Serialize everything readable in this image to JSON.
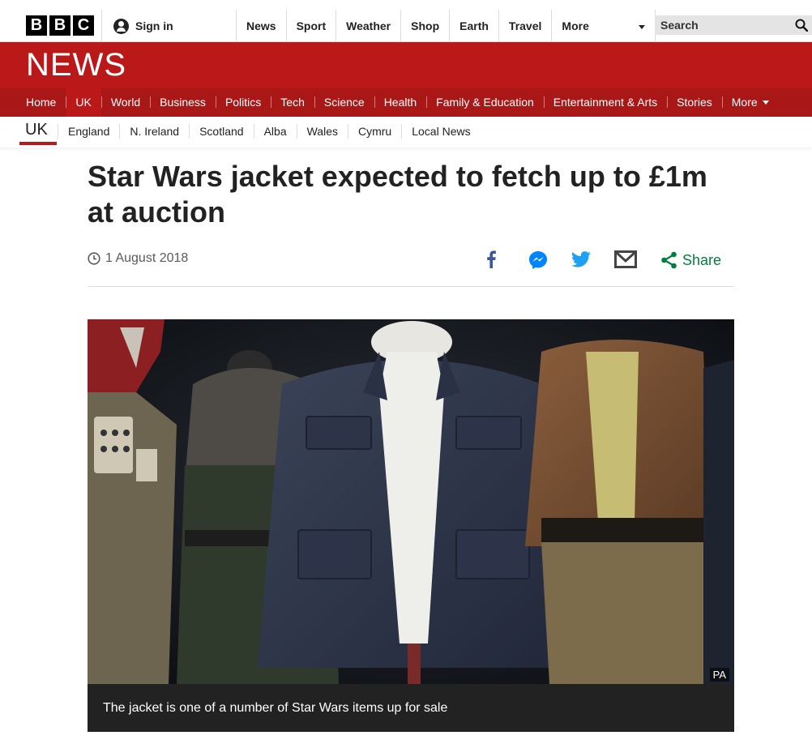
{
  "masthead": {
    "logo_letters": [
      "B",
      "B",
      "C"
    ],
    "signin_label": "Sign in",
    "nav": [
      "News",
      "Sport",
      "Weather",
      "Shop",
      "Earth",
      "Travel"
    ],
    "more_label": "More",
    "search_placeholder": "Search"
  },
  "banner": {
    "title": "NEWS",
    "sections": [
      "Home",
      "UK",
      "World",
      "Business",
      "Politics",
      "Tech",
      "Science",
      "Health",
      "Family & Education",
      "Entertainment & Arts",
      "Stories"
    ],
    "more_label": "More",
    "active_section": "UK"
  },
  "subnav": {
    "current": "UK",
    "links": [
      "England",
      "N. Ireland",
      "Scotland",
      "Alba",
      "Wales",
      "Cymru",
      "Local News"
    ]
  },
  "article": {
    "headline": "Star Wars jacket expected to fetch up to £1m at auction",
    "date": "1 August 2018",
    "share_label": "Share",
    "image_credit": "PA",
    "caption": "The jacket is one of a number of Star Wars items up for sale"
  },
  "colors": {
    "brand_red": "#bb1919",
    "nav_red": "#a91717",
    "share_green": "#007f3f",
    "facebook": "#3b5998",
    "messenger": "#0084ff",
    "twitter": "#1da1f2"
  },
  "icons": [
    "user-icon",
    "search-icon",
    "chevron-down-icon",
    "clock-icon",
    "facebook-icon",
    "messenger-icon",
    "twitter-icon",
    "email-icon",
    "share-icon"
  ]
}
